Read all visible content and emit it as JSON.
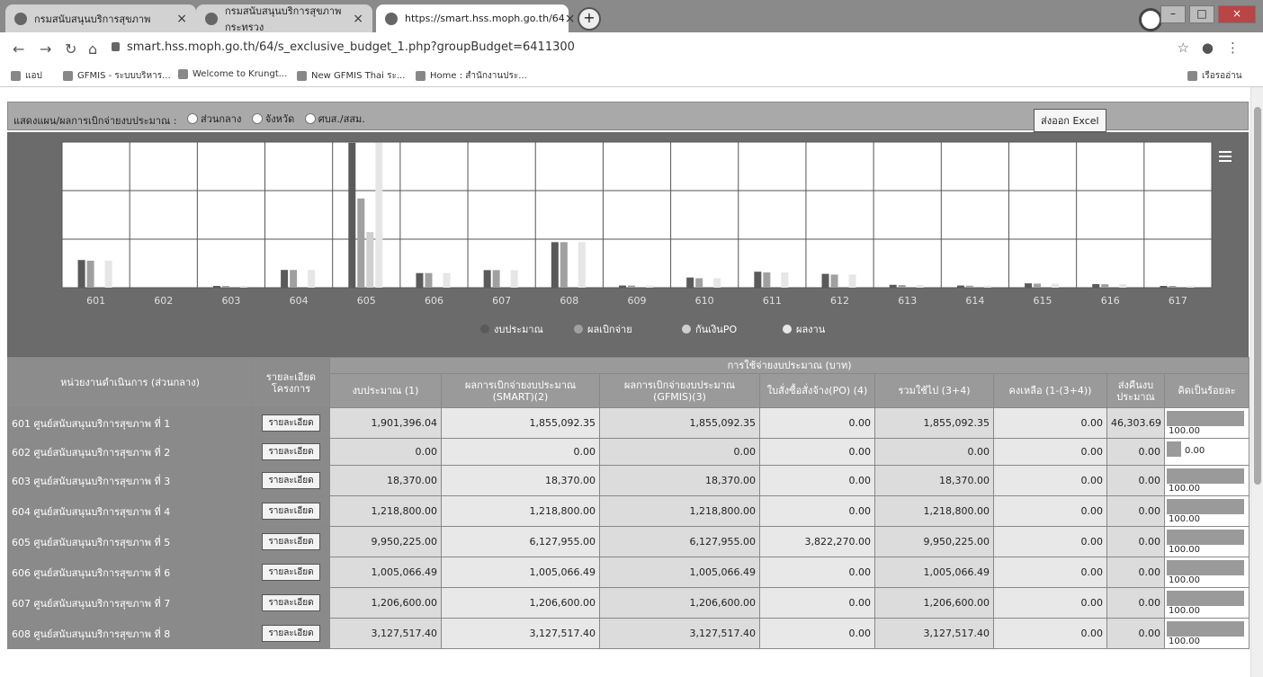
{
  "browser": {
    "tabs": [
      {
        "title": "กรมสนับสนุนบริการสุขภาพ",
        "active": false
      },
      {
        "title": "กรมสนับสนุนบริการสุขภาพ กระทรวง",
        "active": false
      },
      {
        "title": "https://smart.hss.moph.go.th/64",
        "active": true
      }
    ],
    "url": "smart.hss.moph.go.th/64/s_exclusive_budget_1.php?groupBudget=6411300",
    "bookmarks": [
      "แอป",
      "GFMIS - ระบบบริหาร...",
      "Welcome to Krungt...",
      "New GFMIS Thai ระ...",
      "Home : สำนักงานประ..."
    ],
    "reading_list": "เรือรออ่าน"
  },
  "filter": {
    "label": "แสดงแผน/ผลการเบิกจ่ายงบประมาณ :",
    "options": [
      "ส่วนกลาง",
      "จังหวัด",
      "ศบส./สสม."
    ],
    "export_label": "ส่งออก Excel"
  },
  "chart_data": {
    "type": "bar",
    "categories": [
      "601",
      "602",
      "603",
      "604",
      "605",
      "606",
      "607",
      "608",
      "609",
      "610",
      "611",
      "612",
      "613",
      "614",
      "615",
      "616",
      "617"
    ],
    "series": [
      {
        "name": "งบประมาณ",
        "values": [
          1901396.04,
          0,
          18370,
          1218800,
          9950225,
          1005066.49,
          1206600,
          3127517.4,
          150000,
          700000,
          1100000,
          950000,
          200000,
          150000,
          300000,
          250000,
          50000
        ]
      },
      {
        "name": "ผลเบิกจ่าย",
        "values": [
          1855092.35,
          0,
          18370,
          1218800,
          6127955,
          1005066.49,
          1206600,
          3127517.4,
          150000,
          650000,
          1050000,
          900000,
          180000,
          140000,
          280000,
          240000,
          50000
        ]
      },
      {
        "name": "กันเงินPO",
        "values": [
          0,
          0,
          0,
          0,
          3822270,
          0,
          0,
          0,
          0,
          0,
          0,
          0,
          0,
          0,
          0,
          0,
          0
        ]
      },
      {
        "name": "ผลงาน",
        "values": [
          1855092.35,
          0,
          18370,
          1218800,
          9950225,
          1005066.49,
          1206600,
          3127517.4,
          150000,
          650000,
          1050000,
          900000,
          180000,
          140000,
          280000,
          240000,
          50000
        ]
      }
    ],
    "ylim": [
      0,
      10000000
    ],
    "legend_position": "bottom",
    "grid": true,
    "colors": [
      "#5a5a5a",
      "#a0a0a0",
      "#cfcfcf",
      "#e6e6e6"
    ]
  },
  "table": {
    "headers": {
      "unit": "หน่วยงานดำเนินการ (ส่วนกลาง)",
      "detail": "รายละเอียดโครงการ",
      "group": "การใช้จ่ายงบประมาณ (บาท)",
      "budget": "งบประมาณ (1)",
      "smart": "ผลการเบิกจ่ายงบประมาณ (SMART)(2)",
      "gfmis": "ผลการเบิกจ่ายงบประมาณ (GFMIS)(3)",
      "po": "ใบสั่งซื้อสั่งจ้าง(PO) (4)",
      "total": "รวมใช้ไป (3+4)",
      "remain": "คงเหลือ (1-(3+4))",
      "return": "ส่งคืนงบประมาณ",
      "percent": "คิดเป็นร้อยละ"
    },
    "detail_button": "รายละเอียด",
    "rows": [
      {
        "unit": "601 ศูนย์สนับสนุนบริการสุขภาพ ที่ 1",
        "budget": "1,901,396.04",
        "smart": "1,855,092.35",
        "gfmis": "1,855,092.35",
        "po": "0.00",
        "total": "1,855,092.35",
        "remain": "0.00",
        "return": "46,303.69",
        "percent": "100.00",
        "pct_value": 100
      },
      {
        "unit": "602 ศูนย์สนับสนุนบริการสุขภาพ ที่ 2",
        "budget": "0.00",
        "smart": "0.00",
        "gfmis": "0.00",
        "po": "0.00",
        "total": "0.00",
        "remain": "0.00",
        "return": "0.00",
        "percent": "0.00",
        "pct_value": 0
      },
      {
        "unit": "603 ศูนย์สนับสนุนบริการสุขภาพ ที่ 3",
        "budget": "18,370.00",
        "smart": "18,370.00",
        "gfmis": "18,370.00",
        "po": "0.00",
        "total": "18,370.00",
        "remain": "0.00",
        "return": "0.00",
        "percent": "100.00",
        "pct_value": 100
      },
      {
        "unit": "604 ศูนย์สนับสนุนบริการสุขภาพ ที่ 4",
        "budget": "1,218,800.00",
        "smart": "1,218,800.00",
        "gfmis": "1,218,800.00",
        "po": "0.00",
        "total": "1,218,800.00",
        "remain": "0.00",
        "return": "0.00",
        "percent": "100.00",
        "pct_value": 100
      },
      {
        "unit": "605 ศูนย์สนับสนุนบริการสุขภาพ ที่ 5",
        "budget": "9,950,225.00",
        "smart": "6,127,955.00",
        "gfmis": "6,127,955.00",
        "po": "3,822,270.00",
        "total": "9,950,225.00",
        "remain": "0.00",
        "return": "0.00",
        "percent": "100.00",
        "pct_value": 100
      },
      {
        "unit": "606 ศูนย์สนับสนุนบริการสุขภาพ ที่ 6",
        "budget": "1,005,066.49",
        "smart": "1,005,066.49",
        "gfmis": "1,005,066.49",
        "po": "0.00",
        "total": "1,005,066.49",
        "remain": "0.00",
        "return": "0.00",
        "percent": "100.00",
        "pct_value": 100
      },
      {
        "unit": "607 ศูนย์สนับสนุนบริการสุขภาพ ที่ 7",
        "budget": "1,206,600.00",
        "smart": "1,206,600.00",
        "gfmis": "1,206,600.00",
        "po": "0.00",
        "total": "1,206,600.00",
        "remain": "0.00",
        "return": "0.00",
        "percent": "100.00",
        "pct_value": 100
      },
      {
        "unit": "608 ศูนย์สนับสนุนบริการสุขภาพ ที่ 8",
        "budget": "3,127,517.40",
        "smart": "3,127,517.40",
        "gfmis": "3,127,517.40",
        "po": "0.00",
        "total": "3,127,517.40",
        "remain": "0.00",
        "return": "0.00",
        "percent": "100.00",
        "pct_value": 100
      }
    ]
  }
}
